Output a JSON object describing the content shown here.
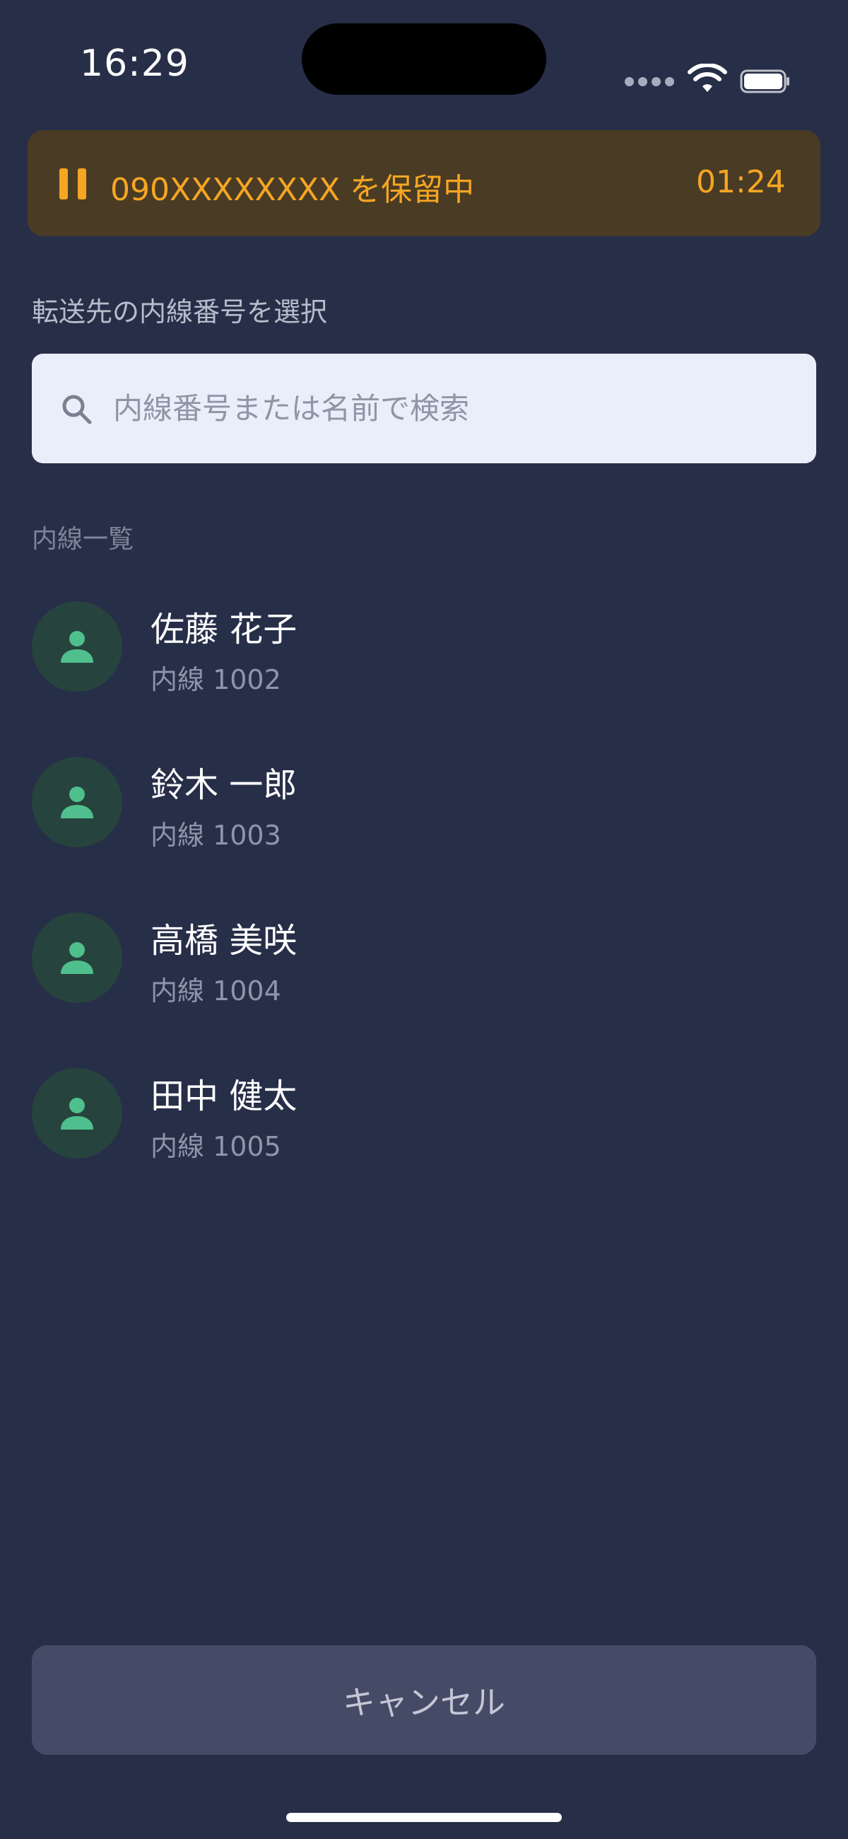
{
  "status_bar": {
    "time": "16:29",
    "signal_icon": "cellular-signal-icon",
    "wifi_icon": "wifi-icon",
    "battery_icon": "battery-icon"
  },
  "hold_banner": {
    "icon": "pause-icon",
    "text": "090XXXXXXXX を保留中",
    "timer": "01:24",
    "accent_color": "#f5a623",
    "background": "#4a3b24"
  },
  "section_title": "転送先の内線番号を選択",
  "search": {
    "icon": "search-icon",
    "value": "",
    "placeholder": "内線番号または名前で検索"
  },
  "list_label": "内線一覧",
  "contacts": [
    {
      "name": "佐藤 花子",
      "extension": "内線 1002"
    },
    {
      "name": "鈴木 一郎",
      "extension": "内線 1003"
    },
    {
      "name": "高橋 美咲",
      "extension": "内線 1004"
    },
    {
      "name": "田中 健太",
      "extension": "内線 1005"
    }
  ],
  "avatar_icon": "person-icon",
  "avatar_color": "#4fc08d",
  "cancel_label": "キャンセル",
  "colors": {
    "background": "#272e48",
    "cancel_button": "#454b67"
  }
}
